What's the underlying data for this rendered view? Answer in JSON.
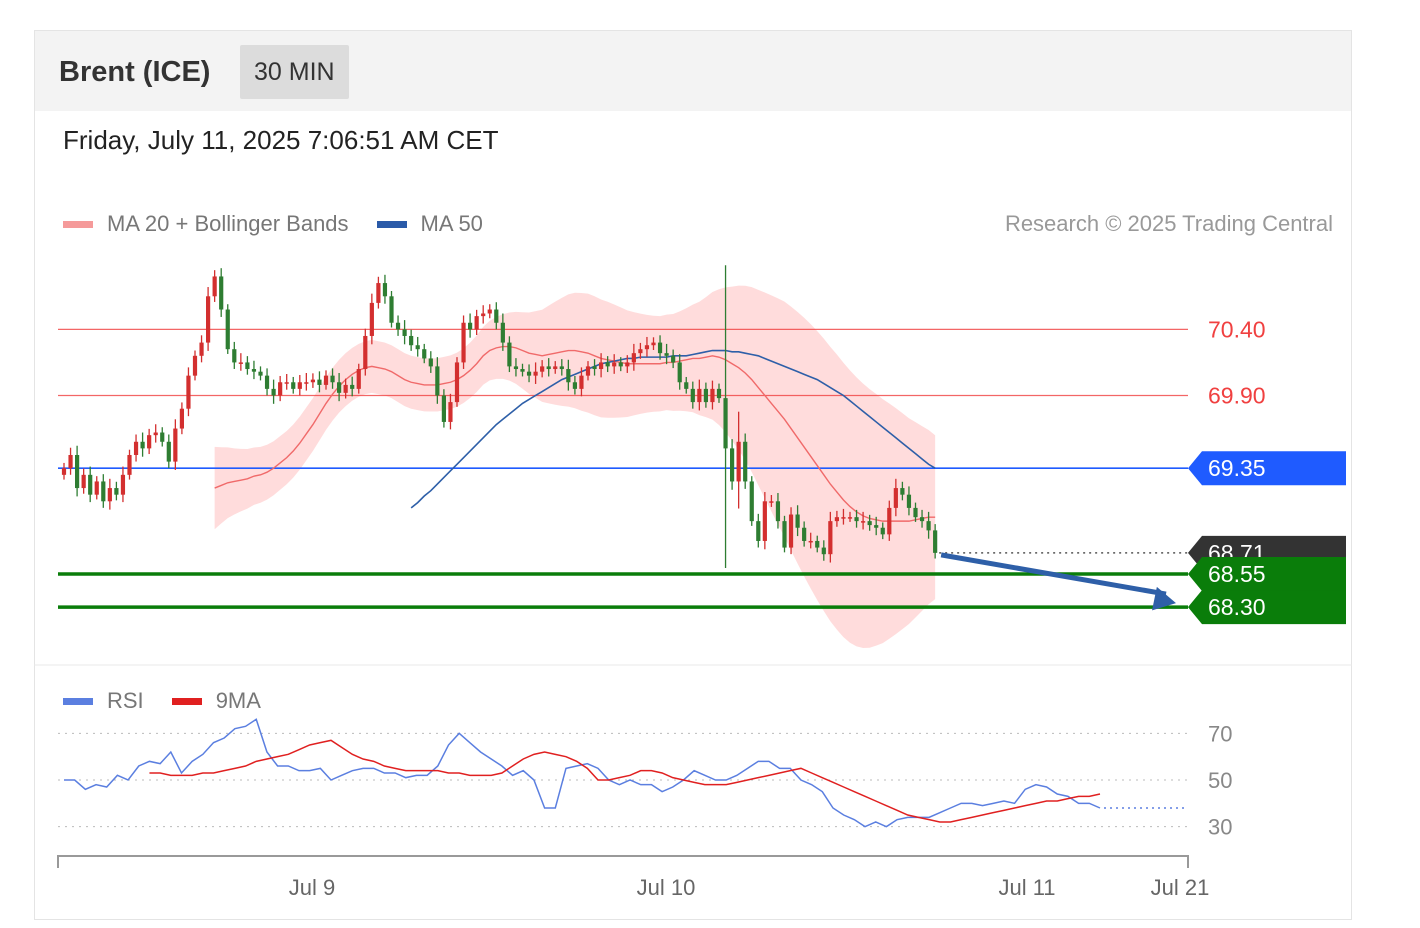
{
  "header": {
    "symbol": "Brent (ICE)",
    "timeframe": "30 MIN"
  },
  "timestamp": "Friday, July 11, 2025 7:06:51 AM CET",
  "price_legend": [
    {
      "label": "MA 20 + Bollinger Bands",
      "color": "#f59a9a"
    },
    {
      "label": "MA 50",
      "color": "#2a5aa8"
    }
  ],
  "copyright": "Research © 2025 Trading Central",
  "rsi_legend": [
    {
      "label": "RSI",
      "color": "#5b7fe0"
    },
    {
      "label": "9MA",
      "color": "#e02020"
    }
  ],
  "colors": {
    "resistance": "#f04040",
    "ma50": "#1f5bff",
    "support": "#0a7d0a",
    "last": "#333333",
    "arrow": "#2e5fa8",
    "band": "#ffd0d0",
    "up": "#d32f2f",
    "down": "#2e7d32"
  },
  "chart_data": [
    {
      "type": "candlestick",
      "y_range": [
        67.9,
        71.0
      ],
      "x_ticks": [
        "Jul 9",
        "Jul 10",
        "Jul 11",
        "Jul 21"
      ],
      "levels": [
        {
          "label": "70.40",
          "value": 70.4,
          "kind": "resistance"
        },
        {
          "label": "69.90",
          "value": 69.9,
          "kind": "resistance"
        },
        {
          "label": "69.35",
          "value": 69.35,
          "kind": "ma50"
        },
        {
          "label": "68.71",
          "value": 68.71,
          "kind": "last"
        },
        {
          "label": "68.55",
          "value": 68.55,
          "kind": "support"
        },
        {
          "label": "68.30",
          "value": 68.3,
          "kind": "support"
        }
      ],
      "close": [
        69.35,
        69.45,
        69.2,
        69.3,
        69.15,
        69.25,
        69.1,
        69.2,
        69.15,
        69.3,
        69.45,
        69.55,
        69.5,
        69.6,
        69.62,
        69.55,
        69.4,
        69.65,
        69.8,
        70.05,
        70.2,
        70.3,
        70.65,
        70.8,
        70.55,
        70.25,
        70.15,
        70.15,
        70.1,
        70.08,
        70.05,
        69.95,
        69.9,
        70.0,
        70.0,
        69.95,
        70.0,
        70.0,
        70.02,
        69.98,
        70.05,
        70.0,
        69.92,
        69.98,
        69.95,
        70.1,
        70.35,
        70.6,
        70.75,
        70.65,
        70.45,
        70.4,
        70.35,
        70.28,
        70.25,
        70.18,
        70.12,
        69.9,
        69.7,
        69.85,
        70.15,
        70.45,
        70.4,
        70.5,
        70.52,
        70.55,
        70.45,
        70.3,
        70.12,
        70.1,
        70.08,
        70.05,
        70.08,
        70.12,
        70.1,
        70.12,
        70.1,
        70.0,
        69.95,
        70.05,
        70.12,
        70.1,
        70.15,
        70.12,
        70.15,
        70.12,
        70.15,
        70.22,
        70.25,
        70.28,
        70.3,
        70.22,
        70.2,
        70.15,
        70.0,
        69.95,
        69.85,
        69.95,
        69.85,
        69.95,
        69.88,
        69.5,
        69.25,
        69.55,
        69.25,
        68.95,
        68.8,
        69.1,
        69.1,
        68.95,
        68.75,
        69.0,
        68.9,
        68.8,
        68.8,
        68.75,
        68.7,
        68.95,
        68.98,
        68.98,
        68.98,
        68.95,
        68.95,
        68.92,
        68.9,
        68.85,
        69.05,
        69.2,
        69.15,
        69.05,
        68.98,
        68.95,
        68.88,
        68.71
      ],
      "ma20": [
        69.2,
        69.22,
        69.24,
        69.25,
        69.26,
        69.27,
        69.29,
        69.3,
        69.32,
        69.35,
        69.39,
        69.43,
        69.48,
        69.54,
        69.61,
        69.68,
        69.76,
        69.84,
        69.91,
        69.97,
        70.02,
        70.06,
        70.09,
        70.11,
        70.12,
        70.11,
        70.1,
        70.08,
        70.05,
        70.02,
        70.0,
        69.99,
        69.98,
        69.98,
        69.98,
        69.99,
        70.0,
        70.02,
        70.05,
        70.09,
        70.14,
        70.2,
        70.24,
        70.26,
        70.27,
        70.27,
        70.26,
        70.24,
        70.22,
        70.21,
        70.2,
        70.21,
        70.22,
        70.23,
        70.24,
        70.24,
        70.23,
        70.22,
        70.2,
        70.18,
        70.17,
        70.16,
        70.15,
        70.14,
        70.14,
        70.14,
        70.14,
        70.14,
        70.14,
        70.15,
        70.15,
        70.16,
        70.17,
        70.18,
        70.18,
        70.19,
        70.2,
        70.19,
        70.17,
        70.14,
        70.11,
        70.07,
        70.02,
        69.96,
        69.9,
        69.84,
        69.78,
        69.72,
        69.65,
        69.58,
        69.51,
        69.44,
        69.37,
        69.3,
        69.23,
        69.17,
        69.11,
        69.06,
        69.02,
        68.99,
        68.97,
        68.96,
        68.95,
        68.95,
        68.95,
        68.95,
        68.95,
        68.96,
        68.97,
        68.98,
        68.98
      ],
      "ma50": [
        69.05,
        69.09,
        69.14,
        69.18,
        69.23,
        69.28,
        69.33,
        69.38,
        69.43,
        69.48,
        69.53,
        69.58,
        69.63,
        69.68,
        69.72,
        69.76,
        69.8,
        69.84,
        69.87,
        69.9,
        69.93,
        69.96,
        69.99,
        70.02,
        70.04,
        70.06,
        70.08,
        70.1,
        70.12,
        70.14,
        70.15,
        70.16,
        70.17,
        70.18,
        70.18,
        70.19,
        70.19,
        70.19,
        70.19,
        70.19,
        70.2,
        70.2,
        70.2,
        70.21,
        70.22,
        70.23,
        70.24,
        70.24,
        70.24,
        70.23,
        70.23,
        70.22,
        70.21,
        70.2,
        70.18,
        70.16,
        70.14,
        70.12,
        70.1,
        70.08,
        70.06,
        70.04,
        70.02,
        69.99,
        69.96,
        69.93,
        69.9,
        69.86,
        69.82,
        69.78,
        69.74,
        69.7,
        69.66,
        69.62,
        69.58,
        69.54,
        69.5,
        69.46,
        69.42,
        69.38,
        69.35
      ]
    },
    {
      "type": "line",
      "y_ticks": [
        70,
        50,
        30
      ],
      "y_range": [
        20,
        80
      ],
      "rsi": [
        50,
        50,
        46,
        48,
        47,
        52,
        50,
        56,
        58,
        57,
        62,
        53,
        58,
        61,
        66,
        68,
        72,
        73,
        76,
        62,
        56,
        56,
        54,
        54,
        55,
        50,
        52,
        54,
        55,
        55,
        53,
        53,
        51,
        52,
        52,
        56,
        65,
        70,
        66,
        62,
        59,
        56,
        52,
        54,
        50,
        38,
        38,
        55,
        56,
        57,
        55,
        50,
        48,
        50,
        48,
        48,
        45,
        47,
        50,
        54,
        52,
        50,
        50,
        52,
        55,
        58,
        58,
        55,
        55,
        50,
        48,
        45,
        38,
        35,
        33,
        30,
        32,
        30,
        33,
        34,
        34,
        34,
        36,
        38,
        40,
        40,
        39,
        40,
        41,
        40,
        46,
        48,
        47,
        44,
        43,
        40,
        40,
        38
      ],
      "rsi_ma": [
        53,
        53,
        52,
        52,
        52,
        53,
        53,
        54,
        55,
        56,
        58,
        59,
        60,
        61,
        63,
        65,
        66,
        67,
        64,
        61,
        59,
        58,
        56,
        55,
        54,
        54,
        54,
        54,
        53,
        53,
        52,
        52,
        52,
        53,
        56,
        59,
        61,
        62,
        61,
        60,
        58,
        55,
        50,
        50,
        51,
        52,
        54,
        54,
        53,
        51,
        50,
        49,
        48,
        48,
        48,
        49,
        50,
        51,
        52,
        53,
        54,
        55,
        53,
        51,
        49,
        47,
        45,
        43,
        41,
        39,
        37,
        35,
        34,
        33,
        32,
        32,
        33,
        34,
        35,
        36,
        37,
        38,
        39,
        40,
        41,
        41,
        42,
        43,
        43,
        44
      ]
    }
  ]
}
